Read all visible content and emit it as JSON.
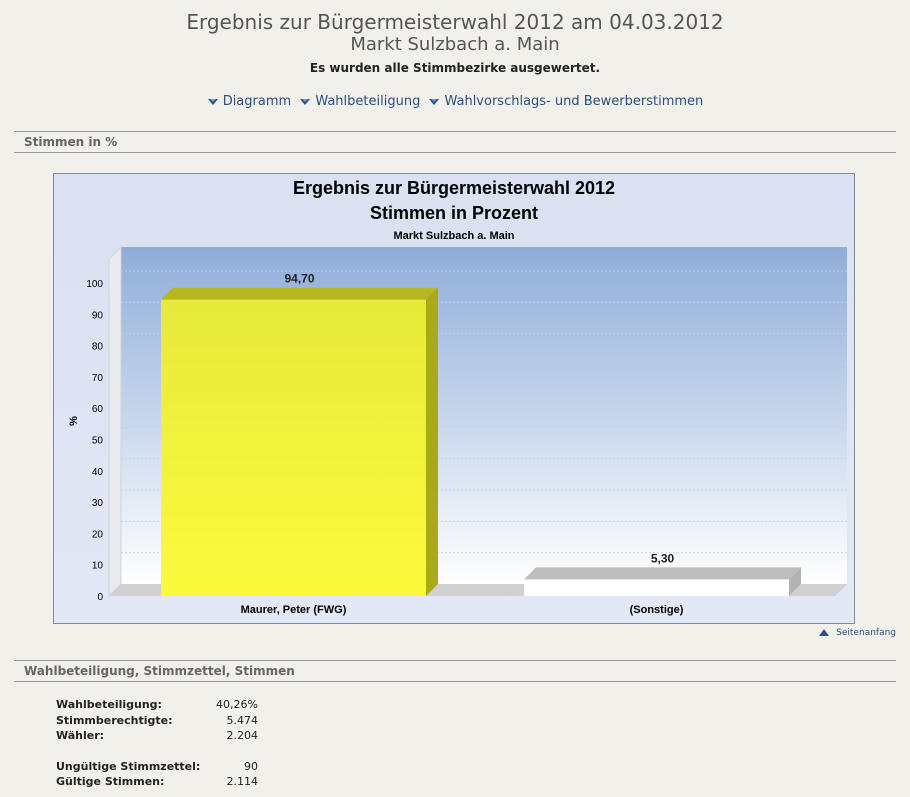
{
  "header": {
    "title_line1": "Ergebnis zur Bürgermeisterwahl 2012 am 04.03.2012",
    "title_line2": "Markt Sulzbach a. Main",
    "status": "Es wurden alle Stimmbezirke ausgewertet."
  },
  "nav": {
    "items": [
      {
        "label": "Diagramm",
        "icon": "down-arrow-icon"
      },
      {
        "label": "Wahlbeteiligung",
        "icon": "down-arrow-icon"
      },
      {
        "label": "Wahlvorschlags- und Bewerberstimmen",
        "icon": "down-arrow-icon"
      }
    ]
  },
  "section1": {
    "title": "Stimmen in %"
  },
  "chart_data": {
    "type": "bar",
    "title": "Ergebnis zur Bürgermeisterwahl 2012",
    "subtitle": "Stimmen in Prozent",
    "caption": "Markt Sulzbach a. Main",
    "ylabel": "%",
    "xlabel": "",
    "ylim": [
      0,
      100
    ],
    "yticks": [
      "0",
      "10",
      "20",
      "30",
      "40",
      "50",
      "60",
      "70",
      "80",
      "90",
      "100"
    ],
    "categories": [
      "Maurer, Peter (FWG)",
      "(Sonstige)"
    ],
    "values": [
      94.7,
      5.3
    ],
    "value_labels": [
      "94,70",
      "5,30"
    ],
    "colors": [
      "#f7f73a",
      "#ffffff"
    ],
    "grid": true,
    "background": "blue-gradient"
  },
  "back_to_top": {
    "label": "Seitenanfang",
    "icon": "up-arrow-icon"
  },
  "section2": {
    "title": "Wahlbeteiligung, Stimmzettel, Stimmen"
  },
  "stats": {
    "wahlbeteiligung_label": "Wahlbeteiligung:",
    "wahlbeteiligung_value": "40,26%",
    "stimmberechtigte_label": "Stimmberechtigte:",
    "stimmberechtigte_value": "5.474",
    "waehler_label": "Wähler:",
    "waehler_value": "2.204",
    "ungueltig_label": "Ungültige Stimmzettel:",
    "ungueltig_value": "90",
    "gueltig_label": "Gültige Stimmen:",
    "gueltig_value": "2.114"
  },
  "colors": {
    "link": "#2a4f83",
    "background": "#f1f0ea",
    "bar_primary": "#f7f73a"
  }
}
